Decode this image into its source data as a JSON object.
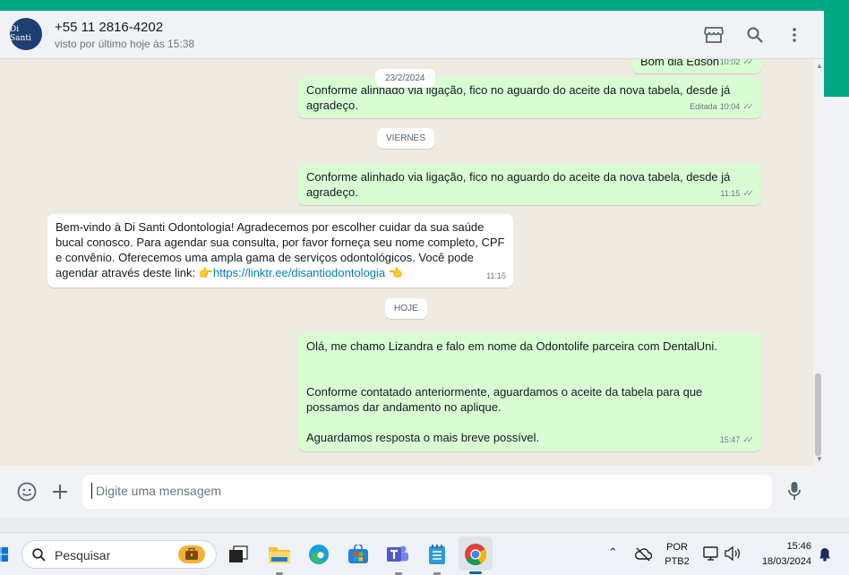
{
  "header": {
    "avatar_text": "Di Santi",
    "contact_name": "+55 11 2816-4202",
    "status": "visto por último hoje às 15:38"
  },
  "icons": [
    "catalog-icon",
    "search-icon",
    "menu-icon",
    "emoji-icon",
    "attach-plus-icon",
    "microphone-icon"
  ],
  "chat": {
    "partial_top_message": {
      "text": "Bom dia Edson",
      "time": "10:02"
    },
    "date_pills": [
      "23/2/2024",
      "VIERNES",
      "HOJE"
    ],
    "messages": [
      {
        "direction": "out",
        "text": "Conforme alinhado via ligação, fico no aguardo do aceite da nova tabela, desde já agradeço.",
        "edited": "Editada",
        "time": "10:04"
      },
      {
        "direction": "out",
        "text": "Conforme alinhado via ligação, fico no aguardo do aceite da nova tabela, desde já agradeço.",
        "time": "11:15"
      },
      {
        "direction": "in",
        "text": "Bem-vindo à Di Santi Odontologia! Agradecemos por escolher cuidar da sua saúde bucal conosco. Para agendar sua consulta, por favor forneça seu nome completo, CPF e convênio. Oferecemos uma ampla gama de serviços odontológicos. Você pode agendar através deste link: 👉",
        "link": "https://linktr.ee/disantiodontologia",
        "text_after": "👈",
        "time": "11:15"
      },
      {
        "direction": "out",
        "paragraphs": [
          "Olá, me chamo Lizandra e falo em nome da Odontolife parceira com DentalUni.",
          "",
          "",
          "Conforme contatado anteriormente, aguardamos o aceite da tabela para que possamos dar andamento no aplique.",
          "",
          "Aguardamos resposta o mais breve possível."
        ],
        "time": "15:47"
      }
    ]
  },
  "composer": {
    "placeholder": "Digite uma mensagem"
  },
  "taskbar": {
    "search_label": "Pesquisar",
    "apps": [
      "windows-start-icon",
      "briefcase-icon",
      "task-view-icon",
      "file-explorer-icon",
      "edge-icon",
      "store-icon",
      "teams-icon",
      "notepad-icon",
      "chrome-icon"
    ],
    "language": "POR",
    "keyboard": "PTB2",
    "time": "15:46",
    "date": "18/03/2024"
  },
  "colors": {
    "accent": "#00a884",
    "outgoing_bubble": "#d9fdd3",
    "incoming_bubble": "#ffffff",
    "chat_bg": "#efeae2"
  }
}
